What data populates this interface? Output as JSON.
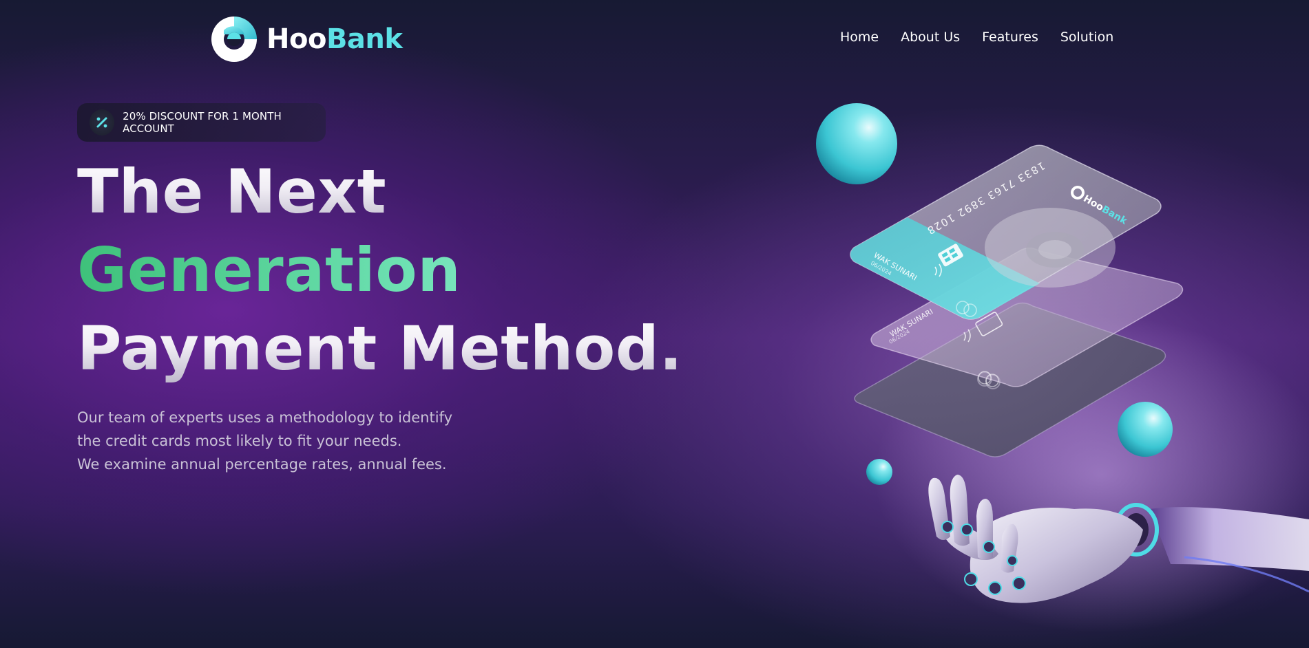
{
  "brand": {
    "name_part1": "Hoo",
    "name_part2": "Bank",
    "accent_color": "#5ce1e6"
  },
  "nav": {
    "items": [
      {
        "label": "Home"
      },
      {
        "label": "About Us"
      },
      {
        "label": "Features"
      },
      {
        "label": "Solution"
      }
    ]
  },
  "hero": {
    "discount": {
      "icon": "percent-icon",
      "text": "20% DISCOUNT FOR 1 MONTH ACCOUNT"
    },
    "headline": {
      "line1": "The Next",
      "line2": "Generation",
      "line3": "Payment Method."
    },
    "paragraph": {
      "line1": "Our team of experts uses a methodology to identify",
      "line2": "the credit cards most likely to fit your needs.",
      "line3": "We examine annual percentage rates, annual fees."
    },
    "illustration": {
      "card_number": "1833 7163 3892 1028",
      "card_holder": "WAK SUNARI",
      "card_expiry": "06/2024",
      "card_brand_part1": "Hoo",
      "card_brand_part2": "Bank"
    }
  },
  "colors": {
    "green_accent": "#3ec17a",
    "teal_accent": "#5ce1e6"
  }
}
